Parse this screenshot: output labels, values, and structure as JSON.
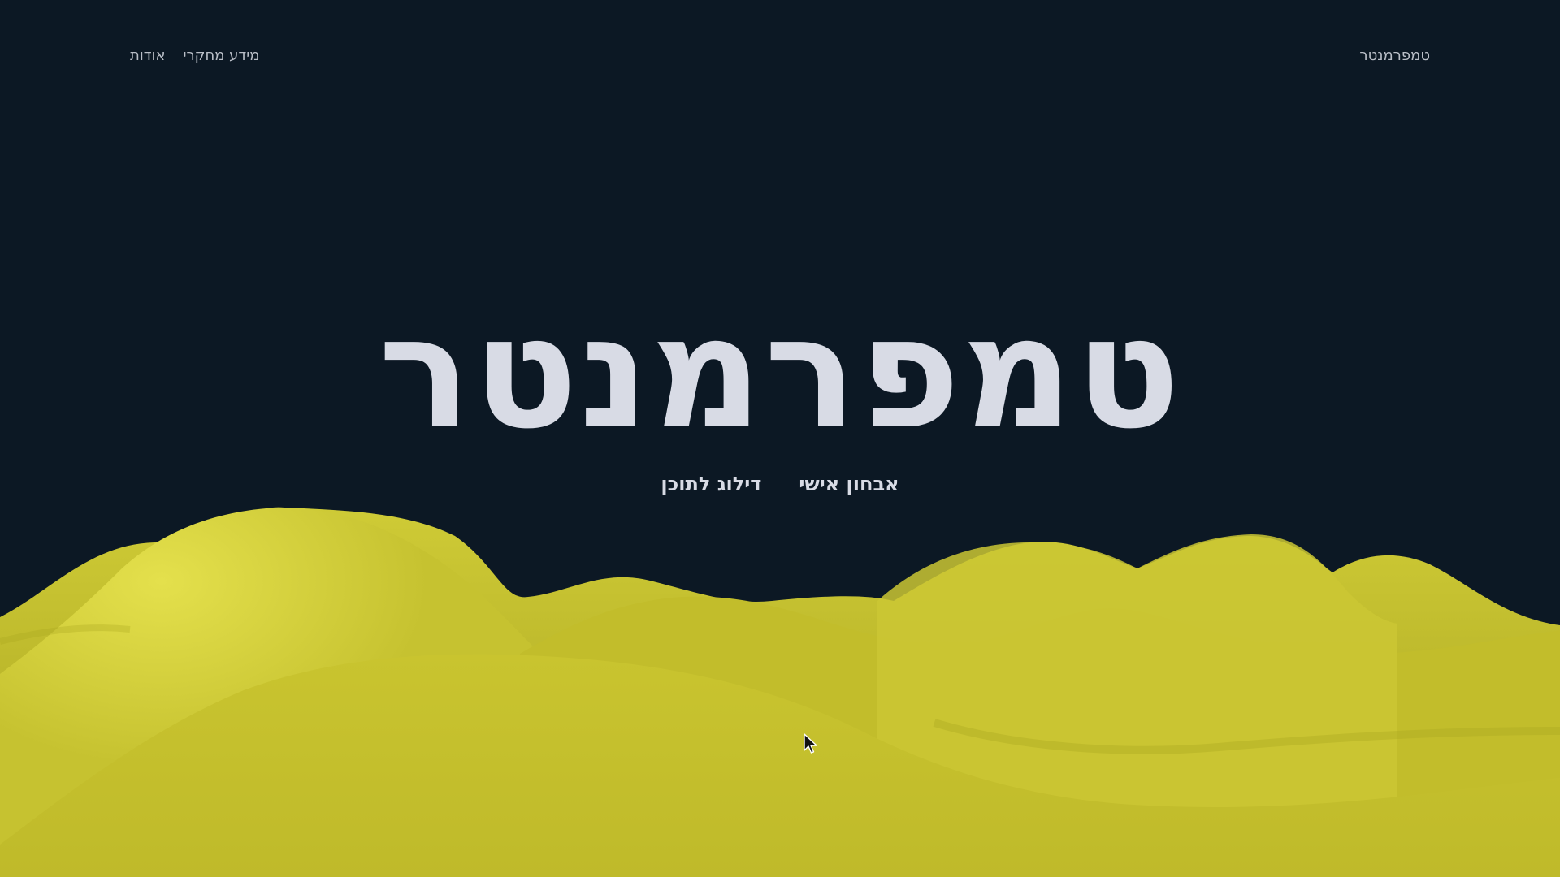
{
  "header": {
    "brand": "טמפרמנטר",
    "nav": [
      {
        "label": "אודות"
      },
      {
        "label": "מידע מחקרי"
      }
    ]
  },
  "hero": {
    "title": "טמפרמנטר",
    "actions": [
      {
        "label": "אבחון אישי"
      },
      {
        "label": "דילוג לתוכן"
      }
    ]
  },
  "colors": {
    "background": "#0c1824",
    "text": "#d8dbe5",
    "nav_text": "#b9bec7",
    "terrain": "#c9c52f",
    "terrain_highlight": "#e2de4a",
    "terrain_shadow": "#9e9a1c"
  },
  "icons": {
    "cursor": "mouse-pointer-icon"
  }
}
